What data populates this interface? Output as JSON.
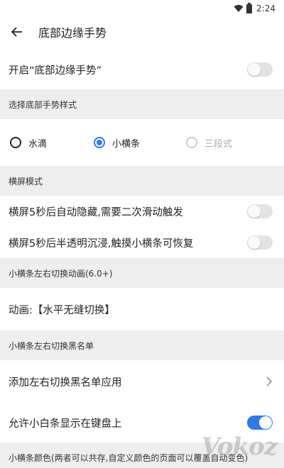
{
  "status_bar": {
    "time": "2:24"
  },
  "app_bar": {
    "title": "底部边缘手势"
  },
  "rows": {
    "enable_gesture": "开启“底部边缘手势”",
    "landscape_hide": "横屏5秒后自动隐藏,需要二次滑动触发",
    "landscape_translucent": "横屏5秒后半透明沉浸,触摸小横条可恢复",
    "animation": "动画:【水平无缝切换】",
    "add_blacklist": "添加左右切换黑名单应用",
    "keyboard_show": "允许小白条显示在键盘上"
  },
  "sections": {
    "gesture_style": "选择底部手势样式",
    "landscape": "横屏模式",
    "switch_animation": "小横条左右切换动画(6.0+)",
    "blacklist": "小横条左右切换黑名单",
    "bar_color": "小横条颜色(两者可以共存,自定义颜色的页面可以覆盖自动变色)"
  },
  "radio_options": [
    {
      "label": "水滴",
      "selected": false,
      "disabled": false
    },
    {
      "label": "小横条",
      "selected": true,
      "disabled": false
    },
    {
      "label": "三段式",
      "selected": false,
      "disabled": true
    }
  ],
  "toggles": {
    "enable_gesture": false,
    "landscape_hide": false,
    "landscape_translucent": false,
    "keyboard_show": true
  },
  "colors": {
    "accent": "#2d7ce5",
    "section_bg": "#eeeeee"
  },
  "watermark": "Vokoz"
}
